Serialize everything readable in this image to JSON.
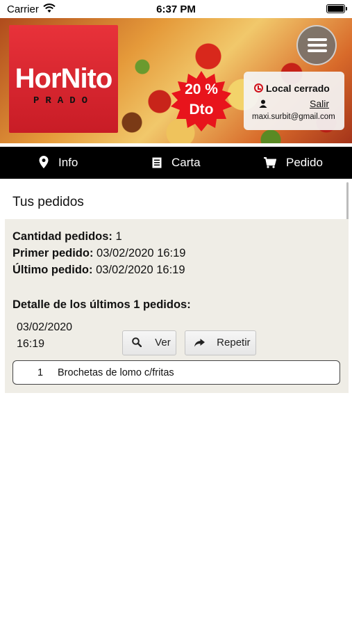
{
  "status_bar": {
    "carrier": "Carrier",
    "time": "6:37 PM"
  },
  "header": {
    "logo": {
      "word": "HorNito",
      "sub": "PRADO"
    },
    "promo": {
      "line1": "20 %",
      "line2": "Dto"
    },
    "status_card": {
      "store_status": "Local cerrado",
      "logout": "Salir",
      "email": "maxi.surbit@gmail.com"
    }
  },
  "nav": {
    "items": [
      {
        "label": "Info",
        "icon": "map-pin-icon"
      },
      {
        "label": "Carta",
        "icon": "menu-list-icon"
      },
      {
        "label": "Pedido",
        "icon": "cart-icon"
      }
    ]
  },
  "orders": {
    "title": "Tus pedidos",
    "count_label": "Cantidad pedidos:",
    "count_value": "1",
    "first_label": "Primer pedido:",
    "first_value": "03/02/2020 16:19",
    "last_label": "Último pedido:",
    "last_value": "03/02/2020 16:19",
    "detail_title": "Detalle de los últimos 1 pedidos:",
    "list": [
      {
        "date": "03/02/2020",
        "time": "16:19",
        "view_label": "Ver",
        "repeat_label": "Repetir",
        "items": [
          {
            "qty": "1",
            "name": "Brochetas de lomo c/fritas"
          }
        ]
      }
    ]
  },
  "colors": {
    "brand_red": "#d0101a",
    "nav_bg": "#000000",
    "panel_bg": "#efede6"
  }
}
